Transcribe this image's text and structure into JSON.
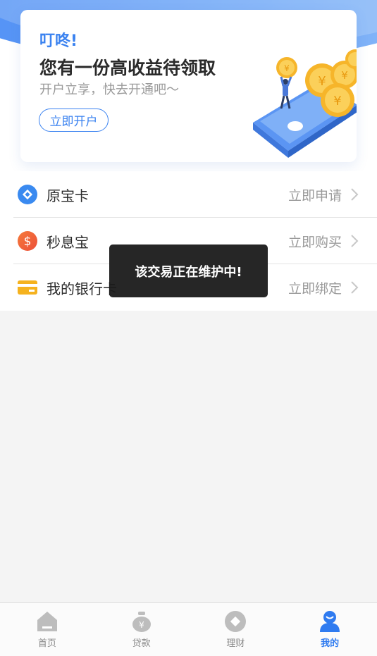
{
  "banner": {
    "greeting": "叮咚!",
    "title": "您有一份高收益待领取",
    "subtitle": "开户立享，快去开通吧～",
    "button_label": "立即开户"
  },
  "menu": {
    "items": [
      {
        "label": "原宝卡",
        "action": "立即申请",
        "icon": "diamond-icon",
        "color": "#3a8af0"
      },
      {
        "label": "秒息宝",
        "action": "立即购买",
        "icon": "dollar-icon",
        "color": "#f0663a"
      },
      {
        "label": "我的银行卡",
        "action": "立即绑定",
        "icon": "bank-card-icon",
        "color": "#f5b21e"
      }
    ]
  },
  "toast": {
    "message": "该交易正在维护中!"
  },
  "tabbar": {
    "tabs": [
      {
        "label": "首页",
        "icon": "home-icon",
        "active": false
      },
      {
        "label": "贷款",
        "icon": "money-bag-icon",
        "active": false
      },
      {
        "label": "理财",
        "icon": "finance-icon",
        "active": false
      },
      {
        "label": "我的",
        "icon": "user-icon",
        "active": true
      }
    ]
  },
  "colors": {
    "accent": "#3a82f0",
    "active_tab": "#2f7bf0",
    "inactive_tab": "#bdbdbd"
  }
}
